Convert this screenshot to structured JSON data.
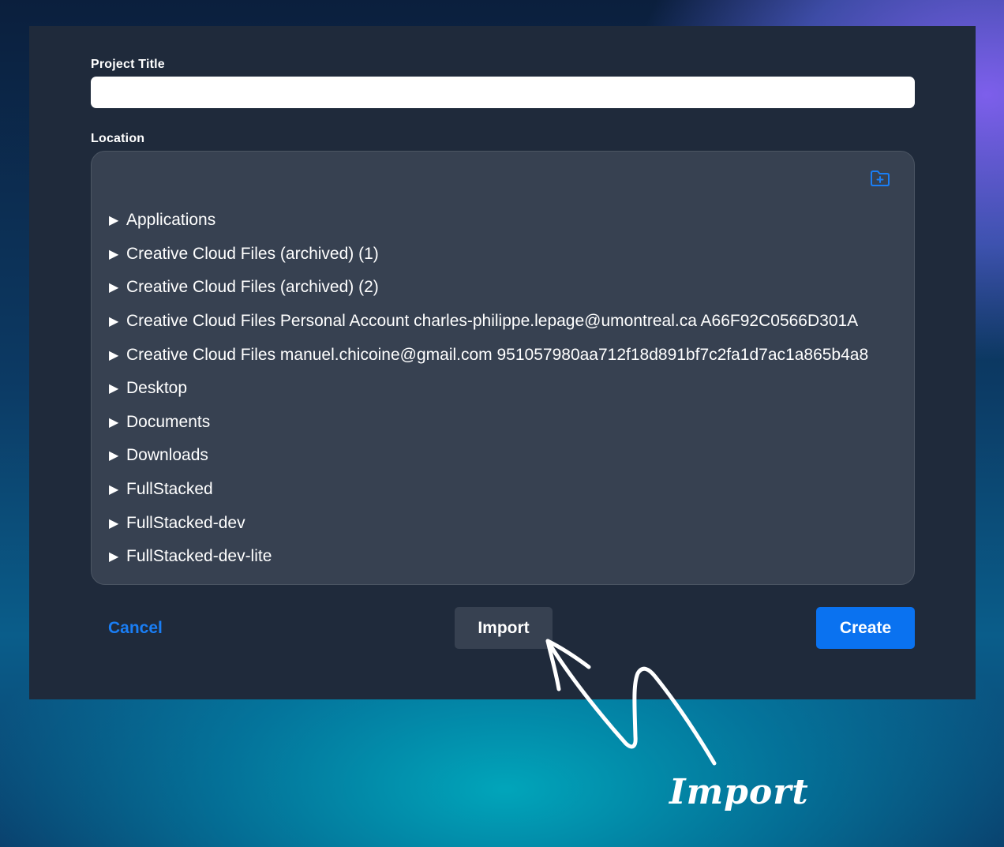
{
  "dialog": {
    "project_title_label": "Project Title",
    "project_title_value": "",
    "location_label": "Location",
    "new_folder_icon": "folder-plus-icon",
    "tree_items": [
      {
        "caret": "▶",
        "label": "Applications"
      },
      {
        "caret": "▶",
        "label": "Creative Cloud Files (archived) (1)"
      },
      {
        "caret": "▶",
        "label": "Creative Cloud Files (archived) (2)"
      },
      {
        "caret": "▶",
        "label": "Creative Cloud Files Personal Account charles-philippe.lepage@umontreal.ca A66F92C0566D301A"
      },
      {
        "caret": "▶",
        "label": "Creative Cloud Files manuel.chicoine@gmail.com 951057980aa712f18d891bf7c2fa1d7ac1a865b4a8"
      },
      {
        "caret": "▶",
        "label": "Desktop"
      },
      {
        "caret": "▶",
        "label": "Documents"
      },
      {
        "caret": "▶",
        "label": "Downloads"
      },
      {
        "caret": "▶",
        "label": "FullStacked"
      },
      {
        "caret": "▶",
        "label": "FullStacked-dev"
      },
      {
        "caret": "▶",
        "label": "FullStacked-dev-lite"
      }
    ],
    "cancel_label": "Cancel",
    "import_label": "Import",
    "create_label": "Create"
  },
  "annotation": {
    "text": "Import",
    "icon": "hand-drawn-arrow-icon"
  },
  "colors": {
    "accent": "#0a72f0",
    "dialog_bg": "#1f2a3b",
    "panel_bg": "#374151"
  }
}
